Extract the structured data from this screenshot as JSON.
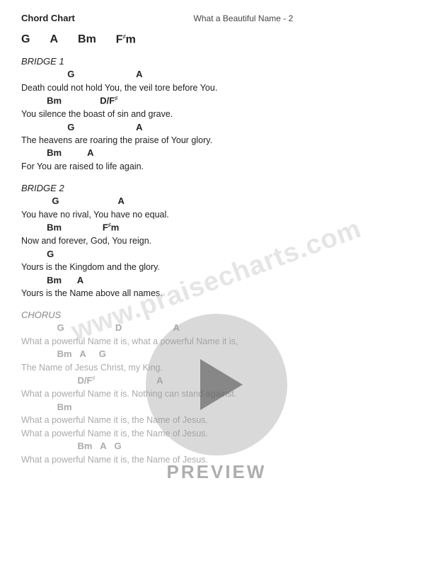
{
  "header": {
    "left": "Chord Chart",
    "center": "What a Beautiful Name - 2",
    "right": ""
  },
  "key_chords": [
    "G",
    "A",
    "Bm",
    "F♯m"
  ],
  "bridge1": {
    "label": "BRIDGE 1",
    "lines": [
      {
        "type": "chord",
        "text": "G",
        "indent": 60
      },
      {
        "type": "chord-inline",
        "text": "A",
        "offset": 200
      },
      {
        "type": "lyric",
        "text": "Death could not hold You, the veil tore before You."
      },
      {
        "type": "chord",
        "text": "Bm",
        "indent": 40
      },
      {
        "type": "chord-inline",
        "text": "D/F♯",
        "offset": 140
      },
      {
        "type": "lyric",
        "text": "You silence the boast of sin and grave."
      },
      {
        "type": "chord",
        "text": "G",
        "indent": 60
      },
      {
        "type": "chord-inline",
        "text": "A",
        "offset": 200
      },
      {
        "type": "lyric",
        "text": "The heavens are roaring the praise of Your glory."
      },
      {
        "type": "chord",
        "text": "Bm",
        "indent": 60
      },
      {
        "type": "chord-inline",
        "text": "A",
        "offset": 160
      },
      {
        "type": "lyric",
        "text": "For You are raised to life again."
      }
    ]
  },
  "bridge2": {
    "label": "BRIDGE 2",
    "lines": [
      {
        "type": "chord",
        "text": "G",
        "indent": 60
      },
      {
        "type": "chord-inline",
        "text": "A",
        "offset": 200
      },
      {
        "type": "lyric",
        "text": "You have no rival, You have no equal."
      },
      {
        "type": "chord",
        "text": "Bm",
        "indent": 40
      },
      {
        "type": "chord-inline",
        "text": "F♯m",
        "offset": 160
      },
      {
        "type": "lyric",
        "text": "Now and forever, God, You reign."
      },
      {
        "type": "chord",
        "text": "G",
        "indent": 40
      },
      {
        "type": "lyric",
        "text": "Yours is the Kingdom and the glory."
      },
      {
        "type": "chord-lyric",
        "chord": "Bm",
        "chord2": "A",
        "offset2": 100
      },
      {
        "type": "lyric",
        "text": "Yours is the Name above all names."
      }
    ]
  },
  "chorus": {
    "label": "CHORUS",
    "lines": [
      {
        "chords": "G                    D                    A"
      },
      {
        "lyric": "What a powerful Name it is, what a powerful Name it is,"
      },
      {
        "chords": "         Bm    A      G"
      },
      {
        "lyric": "The Name of Jesus Christ, my King."
      },
      {
        "chords": "                      D/F♯                       A"
      },
      {
        "lyric": "What a powerful Name it is. Nothing can stand against."
      },
      {
        "chords": "         Bm"
      },
      {
        "lyric": "What a powerful Name it is, the Name of Jesus."
      },
      {
        "chords": "                      Bm      A      G"
      },
      {
        "lyric": "What a powerful Name it is, the Name of Jesus."
      },
      {
        "lyric": "What a powerful Name it is, the Name of Jesus."
      },
      {
        "chords": "                      Bm    A    G"
      },
      {
        "lyric": "What a powerful Name it is, the Name of Jesus."
      }
    ]
  },
  "watermark": "www.praisecharts.com",
  "preview_label": "PREVIEW"
}
